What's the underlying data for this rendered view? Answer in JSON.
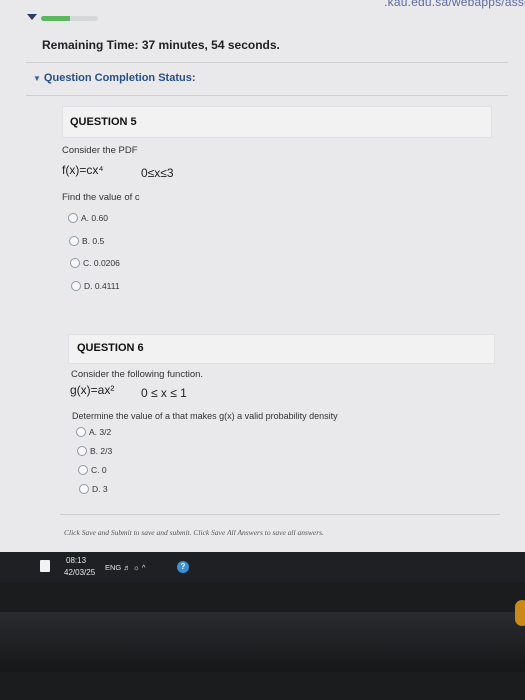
{
  "browser": {
    "url_fragment": ".kau.edu.sa/webapps/asse"
  },
  "header": {
    "progress_fraction": 0.5,
    "remaining_label": "Remaining Time:",
    "remaining_value": "37 minutes, 54 seconds.",
    "completion_status": "Question Completion Status:"
  },
  "questions": [
    {
      "title": "QUESTION 5",
      "prompt": "Consider the PDF",
      "function": "f(x)=cx⁴",
      "domain": "0≤x≤3",
      "ask": "Find the value of c",
      "options": [
        "A. 0.60",
        "B. 0.5",
        "C. 0.0206",
        "D. 0.4111"
      ]
    },
    {
      "title": "QUESTION 6",
      "prompt": "Consider the following function.",
      "function": "g(x)=ax²",
      "domain": "0 ≤ x ≤ 1",
      "ask": "Determine the value of a that makes g(x) a valid probability density",
      "options": [
        "A. 3/2",
        "B. 2/3",
        "C. 0",
        "D. 3"
      ]
    }
  ],
  "footer": {
    "note": "Click Save and Submit to save and submit. Click Save All Answers to save all answers."
  },
  "taskbar": {
    "time": "08:13",
    "date": "42/03/25",
    "tray": "ENG",
    "icons": [
      "document-icon",
      "volume-icon",
      "network-icon",
      "tray-arrow-icon",
      "help-icon"
    ]
  },
  "colors": {
    "accent": "#2a4f86",
    "progress": "#5cb85c",
    "background": "#e9e8ea"
  }
}
